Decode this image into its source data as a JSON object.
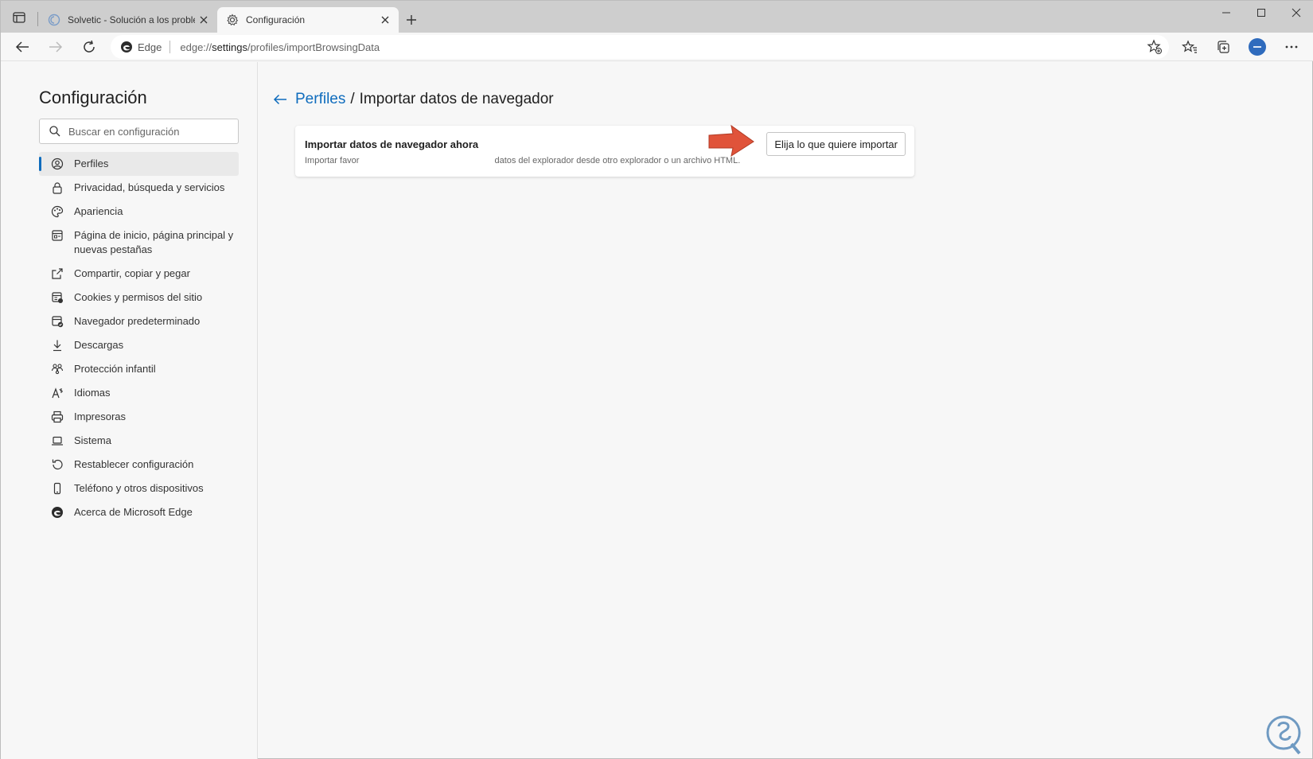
{
  "tabs": [
    {
      "title": "Solvetic - Solución a los problem",
      "active": false
    },
    {
      "title": "Configuración",
      "active": true
    }
  ],
  "address": {
    "identity": "Edge",
    "url_prefix": "edge://",
    "url_host": "settings",
    "url_path": "/profiles/importBrowsingData"
  },
  "sidebar": {
    "title": "Configuración",
    "search_placeholder": "Buscar en configuración",
    "items": [
      {
        "label": "Perfiles",
        "icon": "profile-icon",
        "selected": true
      },
      {
        "label": "Privacidad, búsqueda y servicios",
        "icon": "lock-icon"
      },
      {
        "label": "Apariencia",
        "icon": "palette-icon"
      },
      {
        "label": "Página de inicio, página principal y nuevas pestañas",
        "icon": "home-page-icon"
      },
      {
        "label": "Compartir, copiar y pegar",
        "icon": "share-icon"
      },
      {
        "label": "Cookies y permisos del sitio",
        "icon": "cookies-icon"
      },
      {
        "label": "Navegador predeterminado",
        "icon": "default-browser-icon"
      },
      {
        "label": "Descargas",
        "icon": "download-icon"
      },
      {
        "label": "Protección infantil",
        "icon": "family-icon"
      },
      {
        "label": "Idiomas",
        "icon": "language-icon"
      },
      {
        "label": "Impresoras",
        "icon": "printer-icon"
      },
      {
        "label": "Sistema",
        "icon": "laptop-icon"
      },
      {
        "label": "Restablecer configuración",
        "icon": "reset-icon"
      },
      {
        "label": "Teléfono y otros dispositivos",
        "icon": "phone-icon"
      },
      {
        "label": "Acerca de Microsoft Edge",
        "icon": "edge-icon"
      }
    ]
  },
  "main": {
    "breadcrumb_parent": "Perfiles",
    "breadcrumb_separator": "/",
    "breadcrumb_current": "Importar datos de navegador",
    "card": {
      "title": "Importar datos de navegador ahora",
      "description_left": "Importar favor",
      "description_right": "datos del explorador desde otro explorador o un archivo HTML.",
      "button": "Elija lo que quiere importar"
    }
  },
  "colors": {
    "accent": "#0f6cbd",
    "annotation_arrow": "#e0533a",
    "avatar": "#2f6bbd",
    "tabstrip": "#cecece"
  }
}
